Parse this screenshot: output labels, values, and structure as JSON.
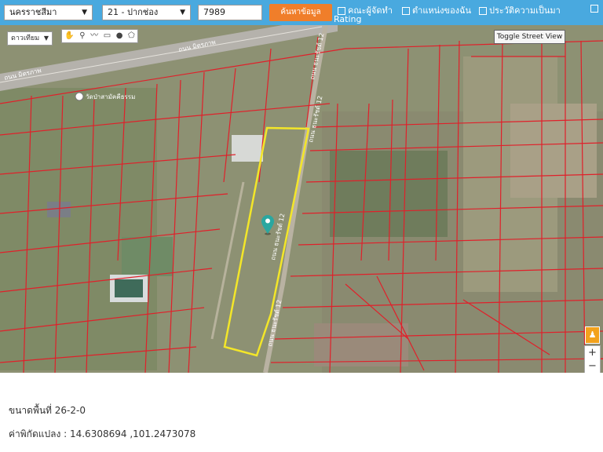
{
  "toolbar": {
    "province": "นครราชสีมา",
    "district": "21 - ปากช่อง",
    "parcel_number": "7989",
    "search_label": "ค้นหาข้อมูล",
    "checkbox_1": "คณะผู้จัดทำ",
    "checkbox_2": "ตำแหน่งของฉัน",
    "checkbox_3": "ประวัติความเป็นมา",
    "rating": "Rating"
  },
  "map": {
    "map_type": "ดาวเทียม",
    "toggle_street_view": "Toggle Street View",
    "zoom_in": "+",
    "zoom_out": "−",
    "labels": {
      "main_road_1": "ถนน มิตรภาพ",
      "main_road_2": "ถนน มิตรภาพ",
      "side_road_1": "ถนน ธนะรัชต์ 12",
      "side_road_2": "ถนน ธนะรัชต์ 12",
      "side_road_3": "ถนน ธนะรัชต์ 12",
      "side_road_4": "ถนน ธนะรัชต์ 12",
      "temple": "วัดป่าสามัคคีธรรม"
    },
    "colors": {
      "parcel_boundary": "#e0202a",
      "selected_parcel": "#f3e629",
      "marker": "#2aa7a0"
    }
  },
  "info": {
    "area": "ขนาดพื้นที่ 26-2-0",
    "coordinates": "ค่าพิกัดแปลง : 14.6308694 ,101.2473078"
  }
}
